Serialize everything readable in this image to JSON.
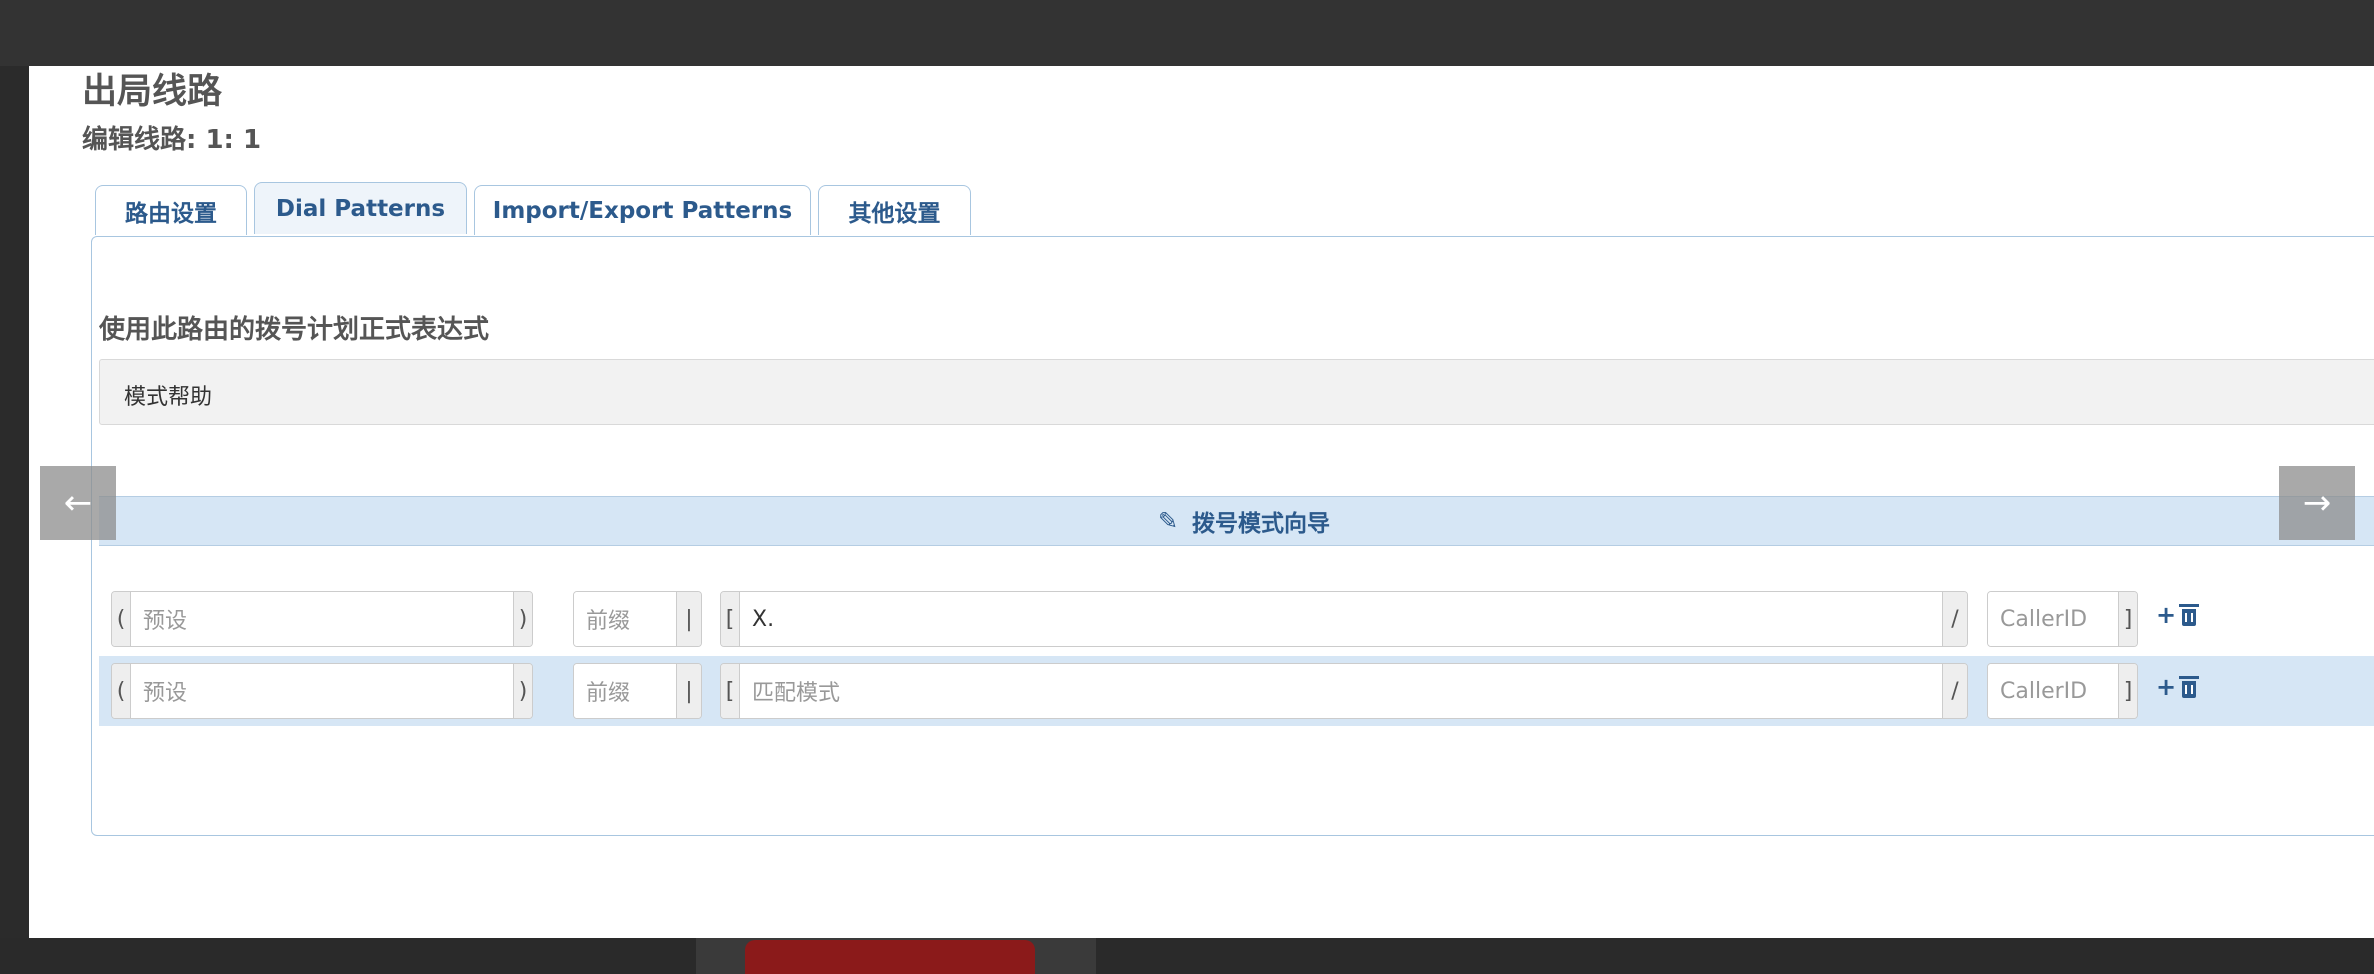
{
  "page": {
    "title": "出局线路",
    "subtitle": "编辑线路: 1: 1"
  },
  "tabs": [
    {
      "label": "路由设置",
      "active": false
    },
    {
      "label": "Dial Patterns",
      "active": true
    },
    {
      "label": "Import/Export Patterns",
      "active": false
    },
    {
      "label": "其他设置",
      "active": false
    }
  ],
  "section": {
    "title": "使用此路由的拨号计划正式表达式",
    "help_label": "模式帮助",
    "help_toggle": "+"
  },
  "wizard": {
    "icon": "magic-wand-icon",
    "label": "拨号模式向导"
  },
  "navigation": {
    "prev": "←",
    "next": "→"
  },
  "patterns": [
    {
      "prepend": {
        "open": "(",
        "value": "",
        "placeholder": "预设",
        "close": ")"
      },
      "prefix": {
        "value": "",
        "placeholder": "前缀",
        "sep": "|"
      },
      "match": {
        "open": "[",
        "value": "X.",
        "placeholder": "匹配模式",
        "close": "/"
      },
      "callerid": {
        "value": "",
        "placeholder": "CallerID",
        "close": "]"
      },
      "add": "+",
      "highlighted": false
    },
    {
      "prepend": {
        "open": "(",
        "value": "",
        "placeholder": "预设",
        "close": ")"
      },
      "prefix": {
        "value": "",
        "placeholder": "前缀",
        "sep": "|"
      },
      "match": {
        "open": "[",
        "value": "",
        "placeholder": "匹配模式",
        "close": "/"
      },
      "callerid": {
        "value": "",
        "placeholder": "CallerID",
        "close": "]"
      },
      "add": "+",
      "highlighted": true
    }
  ],
  "colors": {
    "accent": "#2c5a8c",
    "highlight_row": "#d6e6f5",
    "tab_border": "#a8c6e0"
  }
}
